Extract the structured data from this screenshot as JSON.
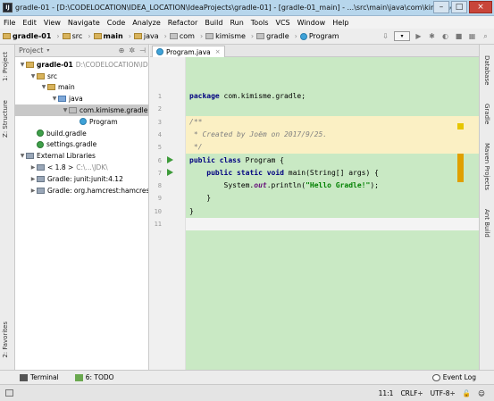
{
  "window": {
    "title": "gradle-01 - [D:\\CODELOCATION\\IDEA_LOCATION\\IdeaProjects\\gradle-01] - [gradle-01_main] - ...\\src\\main\\java\\com\\kimisme\\gradle...",
    "app_icon": "IJ",
    "minimize": "–",
    "maximize": "□",
    "close": "×"
  },
  "menu": [
    "File",
    "Edit",
    "View",
    "Navigate",
    "Code",
    "Analyze",
    "Refactor",
    "Build",
    "Run",
    "Tools",
    "VCS",
    "Window",
    "Help"
  ],
  "breadcrumbs": [
    "gradle-01",
    "src",
    "main",
    "java",
    "com",
    "kimisme",
    "gradle",
    "Program"
  ],
  "project_panel": {
    "title": "Project",
    "tree": [
      {
        "label": "gradle-01",
        "extra": "D:\\CODELOCATION\\IDE",
        "level": 0,
        "icon": "folder-icon",
        "arrow": "▼",
        "bold": true
      },
      {
        "label": "src",
        "extra": "",
        "level": 1,
        "icon": "folder-icon",
        "arrow": "▼"
      },
      {
        "label": "main",
        "extra": "",
        "level": 2,
        "icon": "folder-icon",
        "arrow": "▼"
      },
      {
        "label": "java",
        "extra": "",
        "level": 3,
        "icon": "source-folder-icon",
        "arrow": "▼"
      },
      {
        "label": "com.kimisme.gradle",
        "extra": "",
        "level": 4,
        "icon": "package-icon",
        "arrow": "▼",
        "selected": true
      },
      {
        "label": "Program",
        "extra": "",
        "level": 5,
        "icon": "class-icon",
        "arrow": ""
      },
      {
        "label": "build.gradle",
        "extra": "",
        "level": 1,
        "icon": "gradle-file-icon",
        "arrow": ""
      },
      {
        "label": "settings.gradle",
        "extra": "",
        "level": 1,
        "icon": "gradle-file-icon",
        "arrow": ""
      },
      {
        "label": "External Libraries",
        "extra": "",
        "level": 0,
        "icon": "library-icon",
        "arrow": "▼"
      },
      {
        "label": "< 1.8 >",
        "extra": "C:\\...\\JDK\\",
        "level": 1,
        "icon": "library-icon",
        "arrow": "▶"
      },
      {
        "label": "Gradle: junit:junit:4.12",
        "extra": "",
        "level": 1,
        "icon": "library-icon",
        "arrow": "▶"
      },
      {
        "label": "Gradle: org.hamcrest:hamcrest",
        "extra": "",
        "level": 1,
        "icon": "library-icon",
        "arrow": "▶"
      }
    ]
  },
  "left_tool_tabs": [
    "1: Project",
    "Z: Structure",
    "2: Favorites"
  ],
  "right_tool_tabs": [
    "Database",
    "Gradle",
    "Maven Projects",
    "Ant Build"
  ],
  "editor": {
    "tab_label": "Program.java",
    "line_numbers": [
      "1",
      "2",
      "3",
      "4",
      "5",
      "6",
      "7",
      "8",
      "9",
      "10",
      "11"
    ]
  },
  "code": {
    "l1_kw": "package",
    "l1_rest": " com.kimisme.gradle;",
    "l3": "/**",
    "l4": " * Created by Joëm on 2017/9/25.",
    "l5": " */",
    "l6_kw1": "public",
    "l6_kw2": " class",
    "l6_rest": " Program {",
    "l7_indent": "    ",
    "l7_kw1": "public",
    "l7_kw2": " static",
    "l7_kw3": " void",
    "l7_rest": " main(String[] args) {",
    "l8_a": "        System.",
    "l8_field": "out",
    "l8_b": ".println(",
    "l8_str": "\"Hello Gradle!\"",
    "l8_c": ");",
    "l9": "    }",
    "l10": "}"
  },
  "bottom_tools": {
    "terminal": "Terminal",
    "todo": "6: TODO",
    "event_log": "Event Log"
  },
  "status": {
    "position": "11:1",
    "line_sep": "CRLF÷",
    "encoding": "UTF-8÷"
  },
  "colors": {
    "code_bg": "#c9e9c4",
    "comment_highlight": "#fbf0c4",
    "current_line": "#f4f4f4"
  }
}
